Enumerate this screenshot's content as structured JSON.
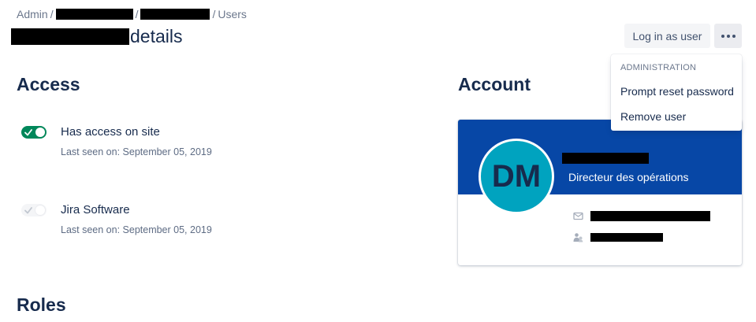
{
  "breadcrumb": {
    "admin": "Admin",
    "users": "Users",
    "separator": "/"
  },
  "page": {
    "title_suffix": "details"
  },
  "header_actions": {
    "login_label": "Log in as user"
  },
  "dropdown": {
    "heading": "ADMINISTRATION",
    "items": [
      "Prompt reset password",
      "Remove user"
    ]
  },
  "access": {
    "title": "Access",
    "products": [
      {
        "name": "Has access on site",
        "last_seen": "Last seen on: September 05, 2019",
        "toggle": "on"
      },
      {
        "name": "Jira Software",
        "last_seen": "Last seen on: September 05, 2019",
        "toggle": "disabled"
      }
    ]
  },
  "account": {
    "title": "Account",
    "initials": "DM",
    "role": "Directeur des opérations",
    "icons": [
      "email-icon",
      "organization-icon"
    ]
  },
  "roles": {
    "title": "Roles"
  },
  "colors": {
    "header_blue": "#0747a6",
    "avatar_teal": "#00a3bf",
    "toggle_green": "#00875a",
    "text_dark": "#172b4d",
    "text_muted": "#6b778c"
  }
}
